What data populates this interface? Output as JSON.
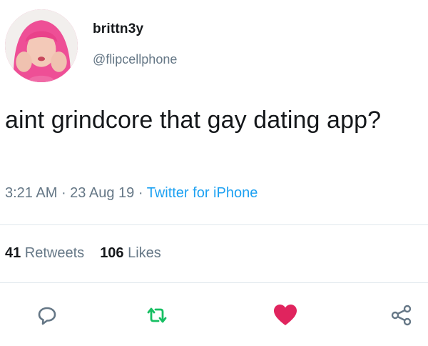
{
  "user": {
    "display_name": "brittn3y",
    "handle": "@flipcellphone",
    "avatar_icon": "profile-photo"
  },
  "tweet": {
    "text": "aint grindcore that gay dating app?",
    "time": "3:21 AM",
    "separator": " · ",
    "date": "23 Aug 19",
    "source": "Twitter for iPhone"
  },
  "stats": {
    "retweets_count": "41",
    "retweets_label": " Retweets",
    "likes_count": "106",
    "likes_label": " Likes"
  },
  "actions": {
    "reply_icon": "reply-icon",
    "retweet_icon": "retweet-icon",
    "like_icon": "heart-icon",
    "share_icon": "share-icon"
  },
  "colors": {
    "link": "#1da1f2",
    "secondary_text": "#657786",
    "retweet": "#17bf63",
    "like": "#e0245e"
  }
}
